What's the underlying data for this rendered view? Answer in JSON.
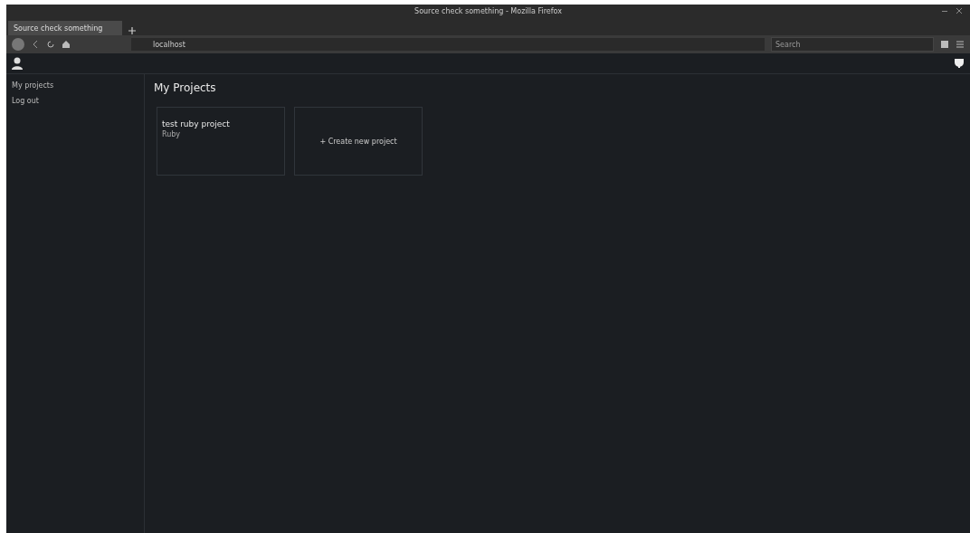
{
  "window": {
    "title": "Source check something - Mozilla Firefox"
  },
  "tabs": [
    {
      "label": "Source check something",
      "selected": true
    }
  ],
  "address_bar": {
    "url": "localhost"
  },
  "search": {
    "placeholder": "Search"
  },
  "sidebar": {
    "items": [
      {
        "label": "My projects",
        "selected": false
      },
      {
        "label": "Log out",
        "selected": false
      }
    ]
  },
  "main": {
    "heading": "My Projects",
    "projects": [
      {
        "title": "test ruby project",
        "subtitle": "Ruby"
      }
    ],
    "create_button": "+ Create new project"
  }
}
